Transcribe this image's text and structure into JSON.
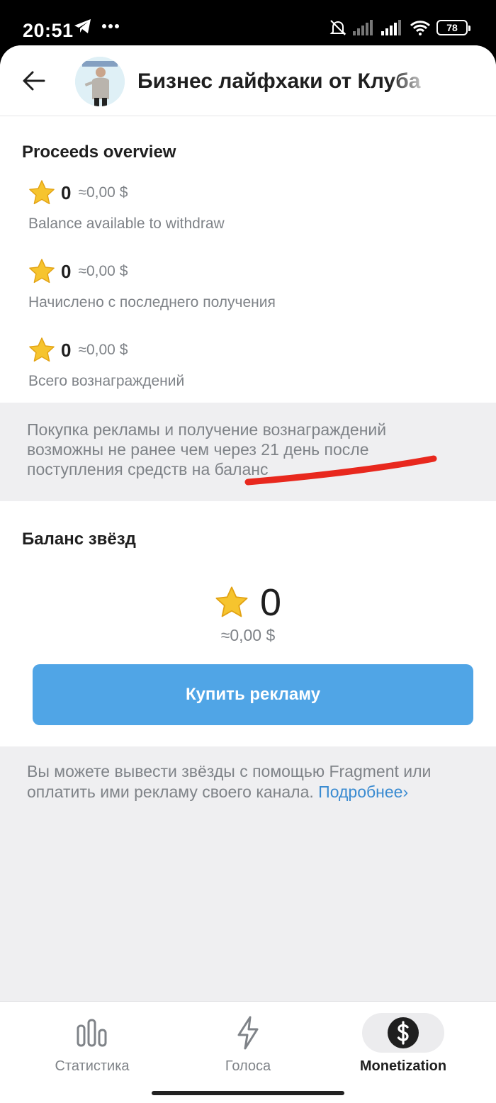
{
  "status_bar": {
    "time": "20:51",
    "battery": "78"
  },
  "header": {
    "title": "Бизнес лайфхаки от Клуба"
  },
  "proceeds": {
    "title": "Proceeds overview",
    "items": [
      {
        "amount": "0",
        "usd": "≈0,00 $",
        "caption": "Balance available to withdraw"
      },
      {
        "amount": "0",
        "usd": "≈0,00 $",
        "caption": "Начислено с последнего получения"
      },
      {
        "amount": "0",
        "usd": "≈0,00 $",
        "caption": "Всего вознаграждений"
      }
    ]
  },
  "note1": {
    "lines": [
      "Покупка рекламы и получение вознаграждений",
      "возможны не ранее чем через 21 день после",
      "поступления средств на баланс"
    ]
  },
  "stars_balance": {
    "title": "Баланс звёзд",
    "amount": "0",
    "usd": "≈0,00 $",
    "buy_button": "Купить рекламу"
  },
  "note2": {
    "line1": "Вы можете вывести звёзды с помощью Fragment или",
    "line2": "оплатить ими рекламу своего канала.",
    "link": "Подробнее",
    "link_chevron": "›"
  },
  "bottom_nav": {
    "items": [
      {
        "label": "Статистика",
        "icon": "bar-chart-icon",
        "active": false
      },
      {
        "label": "Голоса",
        "icon": "lightning-icon",
        "active": false
      },
      {
        "label": "Monetization",
        "icon": "dollar-circle-icon",
        "active": true
      }
    ]
  },
  "colors": {
    "accent": "#50a5e6",
    "link": "#3a8bd1",
    "annotation": "#e8281e"
  }
}
